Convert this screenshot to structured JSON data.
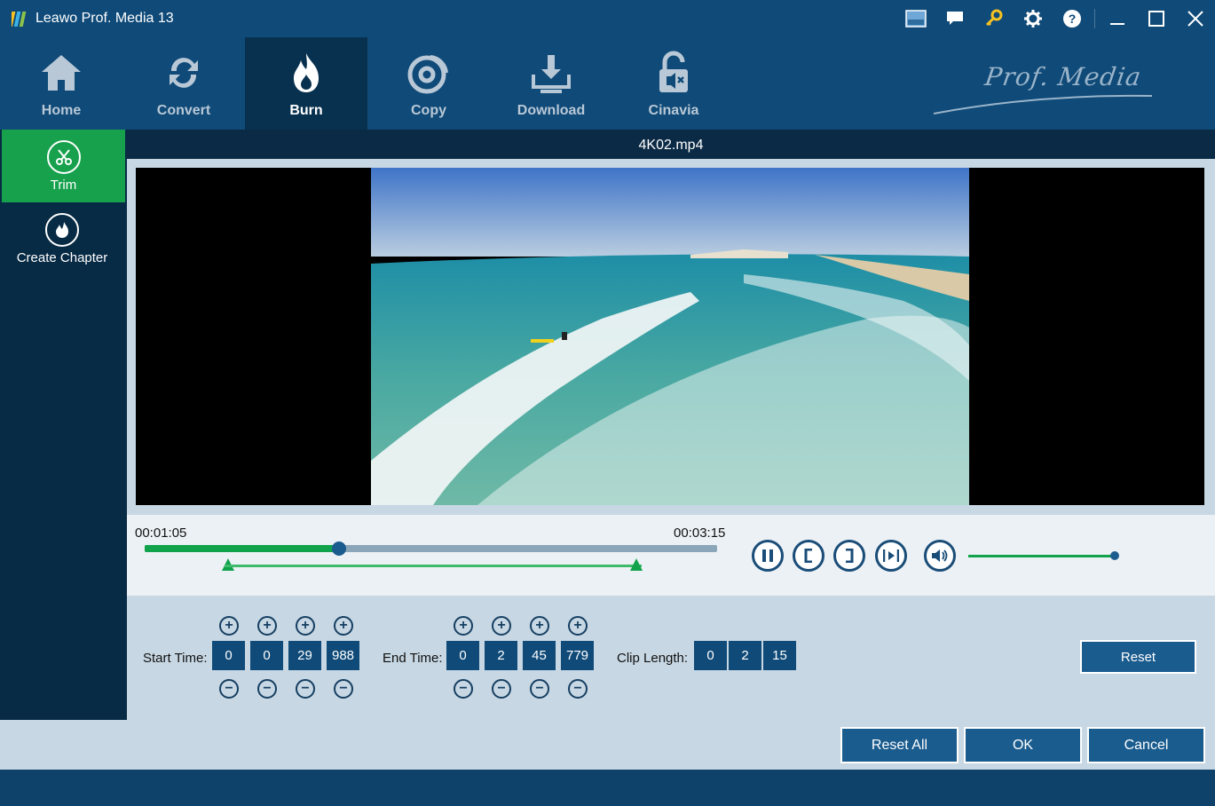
{
  "window": {
    "title": "Leawo Prof. Media 13",
    "icons": [
      "screen-capture-icon",
      "feedback-icon",
      "key-icon",
      "settings-icon",
      "help-icon",
      "minimize-icon",
      "maximize-icon",
      "close-icon"
    ]
  },
  "nav": {
    "items": [
      {
        "label": "Home",
        "icon": "home-icon"
      },
      {
        "label": "Convert",
        "icon": "convert-icon"
      },
      {
        "label": "Burn",
        "icon": "burn-icon",
        "active": true
      },
      {
        "label": "Copy",
        "icon": "copy-icon"
      },
      {
        "label": "Download",
        "icon": "download-icon"
      },
      {
        "label": "Cinavia",
        "icon": "cinavia-icon"
      }
    ]
  },
  "brand": {
    "text": "Prof. Media"
  },
  "sidebar": {
    "items": [
      {
        "label": "Trim",
        "icon": "scissors-icon",
        "active": true
      },
      {
        "label": "Create Chapter",
        "icon": "chapter-icon"
      }
    ]
  },
  "player": {
    "filename": "4K02.mp4",
    "current_time": "00:01:05",
    "total_time": "00:03:15",
    "progress_fraction": 0.34,
    "volume_fraction": 1.0
  },
  "trim": {
    "start_label": "Start Time:",
    "start": [
      "0",
      "0",
      "29",
      "988"
    ],
    "end_label": "End Time:",
    "end": [
      "0",
      "2",
      "45",
      "779"
    ],
    "clip_label": "Clip Length:",
    "clip": [
      "0",
      "2",
      "15"
    ],
    "reset_label": "Reset"
  },
  "footer": {
    "reset_all": "Reset All",
    "ok": "OK",
    "cancel": "Cancel"
  },
  "colors": {
    "accent_green": "#11a34b",
    "primary_blue": "#1b5c8f",
    "topbar_blue": "#0f4a78"
  }
}
